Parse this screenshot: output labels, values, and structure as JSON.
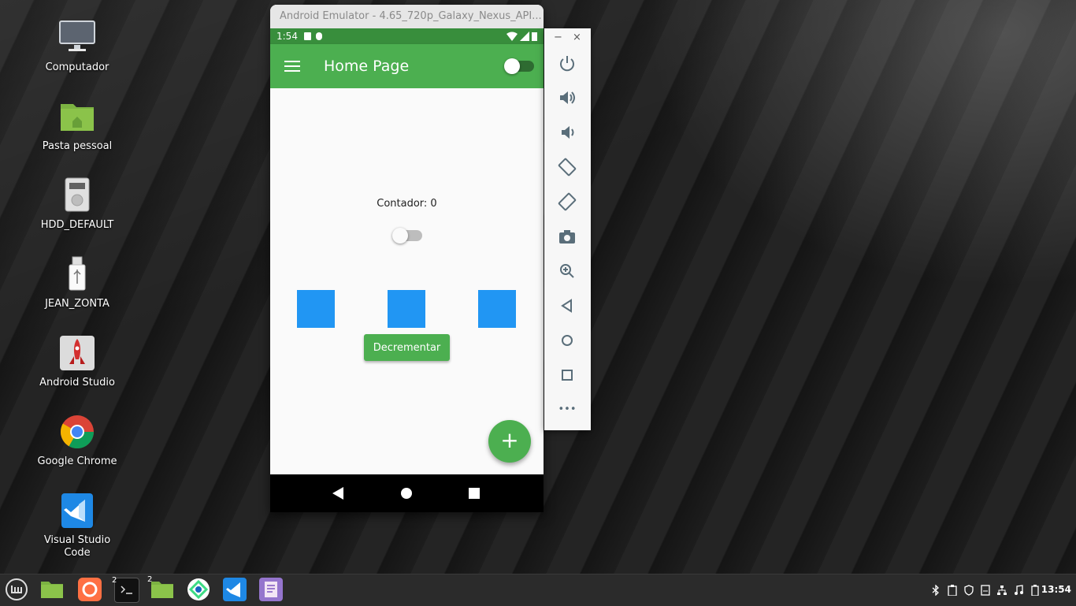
{
  "desktop": {
    "icons": [
      {
        "label": "Computador",
        "icon": "monitor-icon"
      },
      {
        "label": "Pasta pessoal",
        "icon": "home-folder-icon"
      },
      {
        "label": "HDD_DEFAULT",
        "icon": "hard-drive-icon"
      },
      {
        "label": "JEAN_ZONTA",
        "icon": "usb-drive-icon"
      },
      {
        "label": "Android Studio",
        "icon": "android-studio-icon"
      },
      {
        "label": "Google Chrome",
        "icon": "chrome-icon"
      },
      {
        "label": "Visual Studio Code",
        "icon": "vscode-icon"
      }
    ]
  },
  "emulator": {
    "window_title": "Android Emulator - 4.65_720p_Galaxy_Nexus_API...",
    "status_bar": {
      "time": "1:54"
    },
    "app": {
      "title": "Home Page",
      "appbar_switch_on": false,
      "counter_text": "Contador: 0",
      "body_switch_on": false,
      "decrement_label": "Decrementar",
      "fab_label": "+"
    },
    "toolbar": {
      "minimize": "−",
      "close": "×",
      "buttons": [
        "power-icon",
        "volume-up-icon",
        "volume-down-icon",
        "rotate-left-icon",
        "rotate-right-icon",
        "camera-icon",
        "zoom-icon",
        "back-icon",
        "home-icon",
        "overview-icon",
        "more-icon"
      ],
      "more_label": "•••"
    }
  },
  "taskbar": {
    "apps": [
      "mint-menu-icon",
      "files-icon",
      "firefox-icon",
      "terminal-icon",
      "files-icon",
      "android-studio-icon",
      "vscode-icon",
      "text-editor-icon"
    ],
    "terminal_badge": "2",
    "files_badge": "2",
    "tray": [
      "bluetooth-icon",
      "clipboard-icon",
      "shield-icon",
      "update-icon",
      "network-icon",
      "music-icon",
      "battery-icon"
    ],
    "clock": "13:54"
  },
  "colors": {
    "primary": "#4caf50",
    "primary_dark": "#388e3c",
    "square": "#2196f3"
  }
}
